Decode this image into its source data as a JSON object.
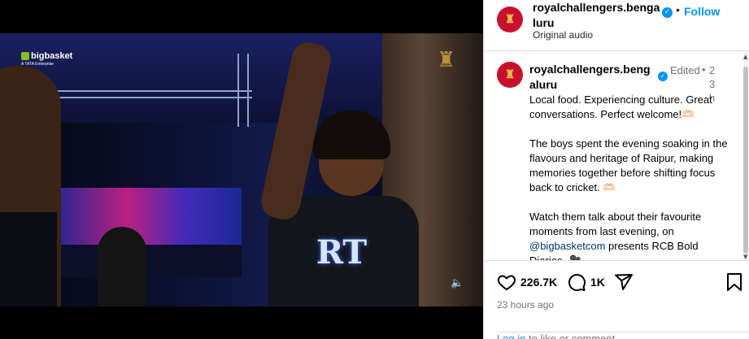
{
  "video": {
    "sponsor_brand": "bigbasket",
    "sponsor_sub": "A TATA Enterprise",
    "shirt_logo": "RT",
    "volume_icon": "volume-icon"
  },
  "header": {
    "username": "royalchallengers.bengaluru",
    "separator": "•",
    "follow_label": "Follow",
    "audio": "Original audio",
    "verified_icon": "verified-badge-icon",
    "avatar_glyph": "♜"
  },
  "caption": {
    "username": "royalchallengers.bengaluru",
    "edited": "Edited",
    "separator": "•",
    "time": "23h",
    "line1": "Local food. Experiencing culture. Great conversations. Perfect welcome!🫶🏻",
    "line2": "The boys spent the evening soaking in the flavours and heritage of Raipur, making memories together before shifting focus back to cricket. 🫶🏻",
    "line3_pre": "Watch them talk about their favourite moments from last evening, on ",
    "line3_mention": "@bigbasketcom",
    "line3_post": " presents RCB Bold Diaries. 🎥"
  },
  "actions": {
    "likes": "226.7K",
    "comments": "1K",
    "time_ago": "23 hours ago",
    "login_link": "Log in",
    "login_rest": " to like or comment."
  },
  "colors": {
    "accent": "#0095f6",
    "brand_red": "#c8102e",
    "muted": "#737373"
  }
}
